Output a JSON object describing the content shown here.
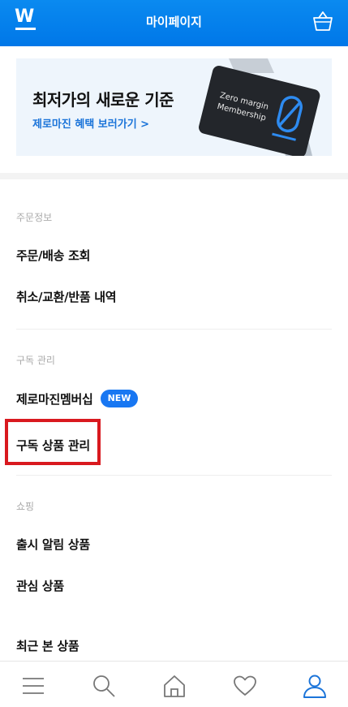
{
  "header": {
    "title": "마이페이지",
    "logo_icon": "wemakeprice-logo-icon",
    "cart_icon": "shopping-basket-icon"
  },
  "banner": {
    "title": "최저가의 새로운 기준",
    "link": "제로마진 혜택 보러가기 >",
    "card_line1": "Zero margin",
    "card_line2": "Membership"
  },
  "sections": {
    "order": {
      "label": "주문정보",
      "items": [
        "주문/배송 조회",
        "취소/교환/반품 내역"
      ]
    },
    "subscription": {
      "label": "구독 관리",
      "items": [
        "제로마진멤버십",
        "구독 상품 관리"
      ],
      "badge": "NEW"
    },
    "shopping": {
      "label": "쇼핑",
      "items": [
        "출시 알림 상품",
        "관심 상품",
        "최근 본 상품"
      ]
    }
  },
  "bottom_nav": {
    "icons": [
      "menu-icon",
      "search-icon",
      "home-icon",
      "heart-icon",
      "user-icon"
    ],
    "active": "user-icon"
  },
  "colors": {
    "brand_blue": "#0077e8",
    "link_blue": "#1b74d9",
    "badge_blue": "#1877f2",
    "highlight_red": "#d9191f"
  }
}
